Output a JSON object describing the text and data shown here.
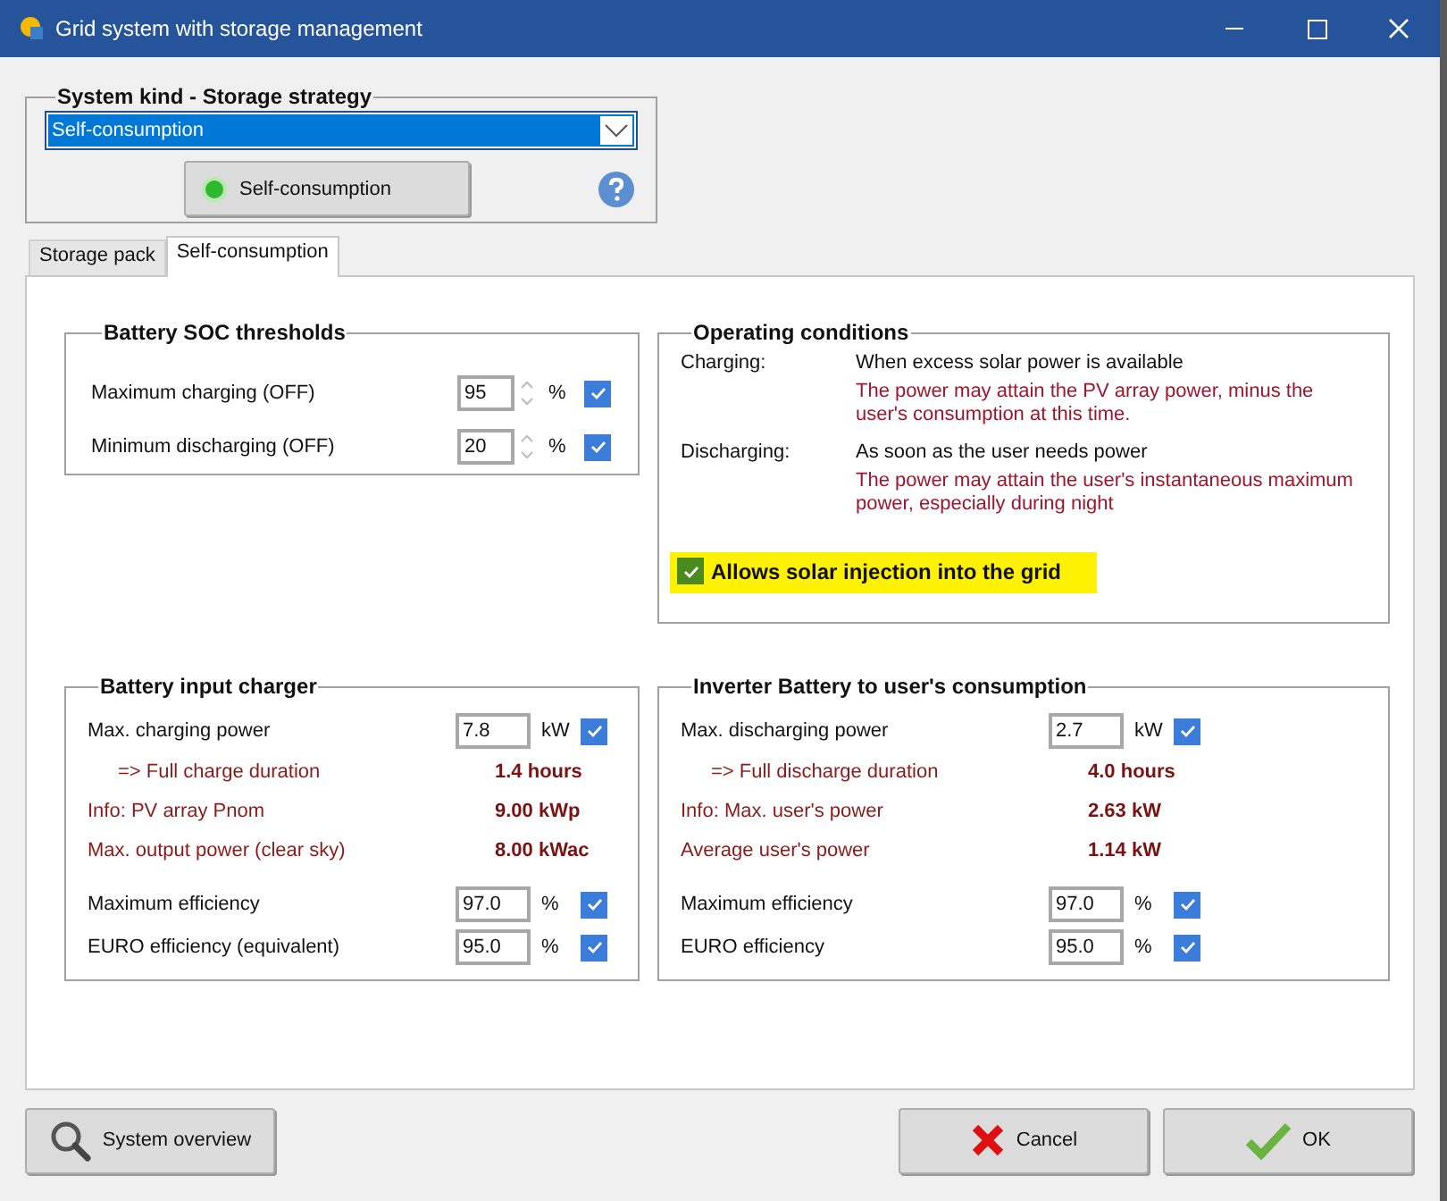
{
  "window": {
    "title": "Grid system with storage management"
  },
  "system_kind": {
    "title": "System kind - Storage strategy",
    "dropdown_value": "Self-consumption",
    "strategy_button": "Self-consumption"
  },
  "tabs": [
    {
      "label": "Storage pack",
      "selected": false
    },
    {
      "label": "Self-consumption",
      "selected": true
    }
  ],
  "soc_thresholds": {
    "title": "Battery SOC thresholds",
    "rows": [
      {
        "label": "Maximum charging  (OFF)",
        "value": "95",
        "unit": "%",
        "checked": true
      },
      {
        "label": "Minimum discharging  (OFF)",
        "value": "20",
        "unit": "%",
        "checked": true
      }
    ]
  },
  "operating_conditions": {
    "title": "Operating conditions",
    "items": [
      {
        "label": "Charging:",
        "text": "When excess solar power is available",
        "note": "The power may attain the PV array power, minus the user's consumption at this time."
      },
      {
        "label": "Discharging:",
        "text": "As soon as the user needs power",
        "note": "The power may attain the user's instantaneous maximum power, especially during night"
      }
    ],
    "injection": {
      "label": "Allows solar injection into the grid",
      "checked": true,
      "highlighted": true
    }
  },
  "charger": {
    "title": "Battery input charger",
    "rows": [
      {
        "kind": "input",
        "label": "Max. charging power",
        "value": "7.8",
        "unit": "kW",
        "checked": true
      },
      {
        "kind": "result",
        "label": "=> Full charge duration",
        "value": "1.4  hours"
      },
      {
        "kind": "info",
        "label": "Info: PV array Pnom",
        "value": "9.00 kWp"
      },
      {
        "kind": "info",
        "label": "Max. output power (clear sky)",
        "value": "8.00 kWac"
      },
      {
        "kind": "input",
        "label": "Maximum efficiency",
        "value": "97.0",
        "unit": "%",
        "checked": true
      },
      {
        "kind": "input",
        "label": "EURO efficiency (equivalent)",
        "value": "95.0",
        "unit": "%",
        "checked": true
      }
    ]
  },
  "inverter": {
    "title": "Inverter Battery to user's consumption",
    "rows": [
      {
        "kind": "input",
        "label": "Max. discharging power",
        "value": "2.7",
        "unit": "kW",
        "checked": true
      },
      {
        "kind": "result",
        "label": "=> Full discharge duration",
        "value": "4.0  hours"
      },
      {
        "kind": "info",
        "label": "Info: Max. user's power",
        "value": "2.63 kW"
      },
      {
        "kind": "info",
        "label": "Average user's power",
        "value": "1.14 kW"
      },
      {
        "kind": "input",
        "label": "Maximum efficiency",
        "value": "97.0",
        "unit": "%",
        "checked": true
      },
      {
        "kind": "input",
        "label": "EURO efficiency",
        "value": "95.0",
        "unit": "%",
        "checked": true
      }
    ]
  },
  "buttons": [
    {
      "kind": "overview",
      "label": "System overview"
    },
    {
      "kind": "cancel",
      "label": "Cancel"
    },
    {
      "kind": "ok",
      "label": "OK"
    }
  ]
}
